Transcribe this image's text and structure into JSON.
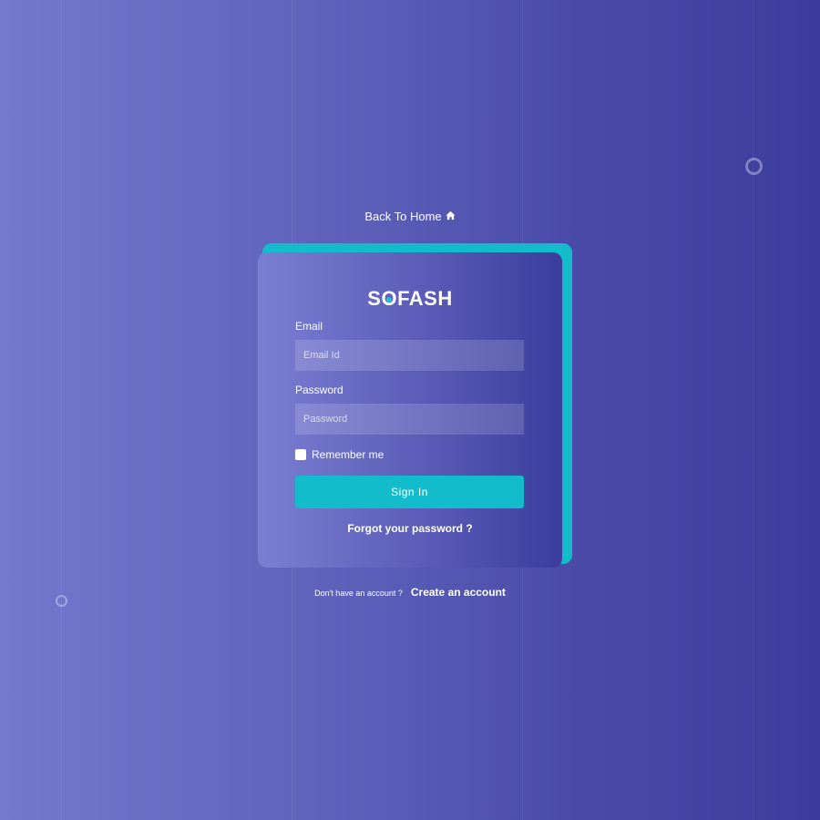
{
  "nav": {
    "back_home_label": "Back To Home",
    "home_icon": "home-icon"
  },
  "brand": {
    "name_prefix": "S",
    "name_o": "O",
    "name_suffix": "FASH",
    "accent": "#12bccb"
  },
  "form": {
    "email_label": "Email",
    "email_placeholder": "Email Id",
    "email_value": "",
    "password_label": "Password",
    "password_placeholder": "Password",
    "password_value": "",
    "remember_label": "Remember me",
    "remember_checked": false,
    "signin_label": "Sign In",
    "forgot_label": "Forgot your password ?"
  },
  "footer": {
    "no_account_text": "Don't have an account ?",
    "create_account_label": "Create an account"
  },
  "colors": {
    "background_start": "#7479cf",
    "background_end": "#3c3c9c",
    "button": "#12bccb",
    "card_shadow": "#12bccb"
  }
}
